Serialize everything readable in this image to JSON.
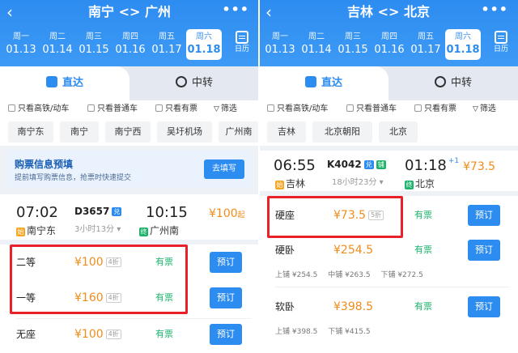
{
  "left": {
    "title": "南宁 <> 广州",
    "days": [
      {
        "week": "周一",
        "date": "01.13"
      },
      {
        "week": "周二",
        "date": "01.14"
      },
      {
        "week": "周三",
        "date": "01.15"
      },
      {
        "week": "周四",
        "date": "01.16"
      },
      {
        "week": "周五",
        "date": "01.17"
      },
      {
        "week": "周六",
        "date": "01.18",
        "selected": true
      }
    ],
    "calendar_label": "日历",
    "mode_direct": "直达",
    "mode_transfer": "中转",
    "filters": [
      "只看高铁/动车",
      "只看普通车",
      "只看有票",
      "筛选"
    ],
    "stations": [
      "南宁东",
      "南宁",
      "南宁西",
      "吴圩机场",
      "广州南"
    ],
    "notice": {
      "title": "购票信息预填",
      "subtitle": "提前填写购票信息，抢票时快速提交",
      "button": "去填写"
    },
    "train": {
      "depart_time": "07:02",
      "number": "D3657",
      "badge": "兑",
      "arrive_time": "10:15",
      "duration": "3小时13分 ▾",
      "from_icon": "始",
      "from": "南宁东",
      "to_icon": "终",
      "to": "广州南",
      "price": "¥100",
      "price_suffix": "起"
    },
    "seats": [
      {
        "name": "二等",
        "price": "¥100",
        "discount": "4折",
        "status": "有票",
        "button": "预订"
      },
      {
        "name": "一等",
        "price": "¥160",
        "discount": "4折",
        "status": "有票",
        "button": "预订"
      },
      {
        "name": "无座",
        "price": "¥100",
        "discount": "4折",
        "status": "有票",
        "button": "预订"
      }
    ]
  },
  "right": {
    "title": "吉林 <> 北京",
    "days": [
      {
        "week": "周一",
        "date": "01.13"
      },
      {
        "week": "周二",
        "date": "01.14"
      },
      {
        "week": "周三",
        "date": "01.15"
      },
      {
        "week": "周四",
        "date": "01.16"
      },
      {
        "week": "周五",
        "date": "01.17"
      },
      {
        "week": "周六",
        "date": "01.18",
        "selected": true
      }
    ],
    "calendar_label": "日历",
    "mode_direct": "直达",
    "mode_transfer": "中转",
    "filters": [
      "只看高铁/动车",
      "只看普通车",
      "只看有票",
      "筛选"
    ],
    "stations": [
      "吉林",
      "北京朝阳",
      "北京"
    ],
    "train": {
      "depart_time": "06:55",
      "number": "K4042",
      "badge1": "兑",
      "badge2": "铺",
      "arrive_time": "01:18",
      "arrive_plus": "+1",
      "duration": "18小时23分 ▾",
      "from_icon": "始",
      "from": "吉林",
      "to_icon": "终",
      "to": "北京",
      "price": "¥73.5"
    },
    "seats": [
      {
        "name": "硬座",
        "price": "¥73.5",
        "discount": "5折",
        "status": "有票",
        "button": "预订"
      },
      {
        "name": "硬卧",
        "price": "¥254.5",
        "status": "有票",
        "button": "预订",
        "berths": [
          "上铺 ¥254.5",
          "中铺 ¥263.5",
          "下铺 ¥272.5"
        ]
      },
      {
        "name": "软卧",
        "price": "¥398.5",
        "status": "有票",
        "button": "预订",
        "berths": [
          "上铺 ¥398.5",
          "下铺 ¥415.5"
        ]
      }
    ]
  },
  "colors": {
    "brand": "#2d8cf0",
    "price": "#f08c1a",
    "available": "#1db36b",
    "highlight": "#e8202a"
  }
}
